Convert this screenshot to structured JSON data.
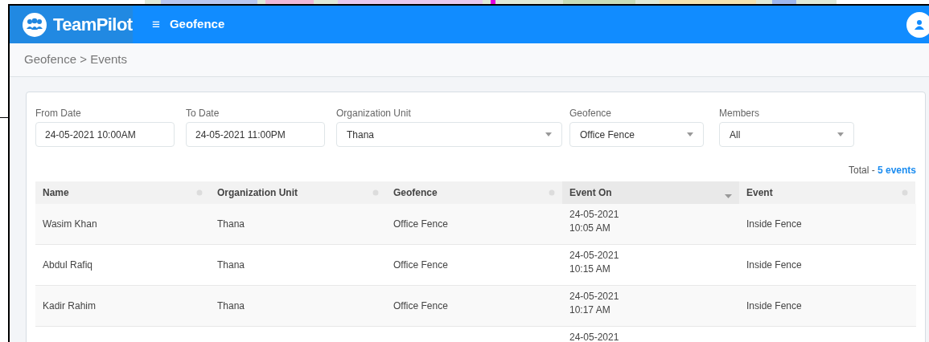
{
  "header": {
    "logo_text": "TeamPilot",
    "menu_icon": "≡",
    "title": "Geofence"
  },
  "breadcrumb": "Geofence > Events",
  "filters": [
    {
      "kind": "input",
      "label": "From Date",
      "value": "24-05-2021 10:00AM"
    },
    {
      "kind": "input",
      "label": "To Date",
      "value": "24-05-2021 11:00PM"
    },
    {
      "kind": "select",
      "label": "Organization Unit",
      "value": "Thana"
    },
    {
      "kind": "select",
      "label": "Geofence",
      "value": "Office Fence"
    },
    {
      "kind": "select",
      "label": "Members",
      "value": "All"
    }
  ],
  "total": {
    "label": "Total - ",
    "link": "5 events"
  },
  "table": {
    "columns": [
      {
        "label": "Name",
        "sorted": false
      },
      {
        "label": "Organization Unit",
        "sorted": false
      },
      {
        "label": "Geofence",
        "sorted": false
      },
      {
        "label": "Event On",
        "sorted": true
      },
      {
        "label": "Event",
        "sorted": false
      }
    ],
    "rows": [
      {
        "cells": [
          "Wasim Khan",
          "Thana",
          "Office Fence",
          "24-05-2021\n10:05 AM",
          "Inside Fence"
        ]
      },
      {
        "cells": [
          "Abdul Rafiq",
          "Thana",
          "Office Fence",
          "24-05-2021\n10:15 AM",
          "Inside Fence"
        ]
      },
      {
        "cells": [
          "Kadir Rahim",
          "Thana",
          "Office Fence",
          "24-05-2021\n10:17 AM",
          "Inside Fence"
        ]
      },
      {
        "cells": [
          "",
          "",
          "",
          "24-05-2021",
          ""
        ]
      }
    ]
  }
}
